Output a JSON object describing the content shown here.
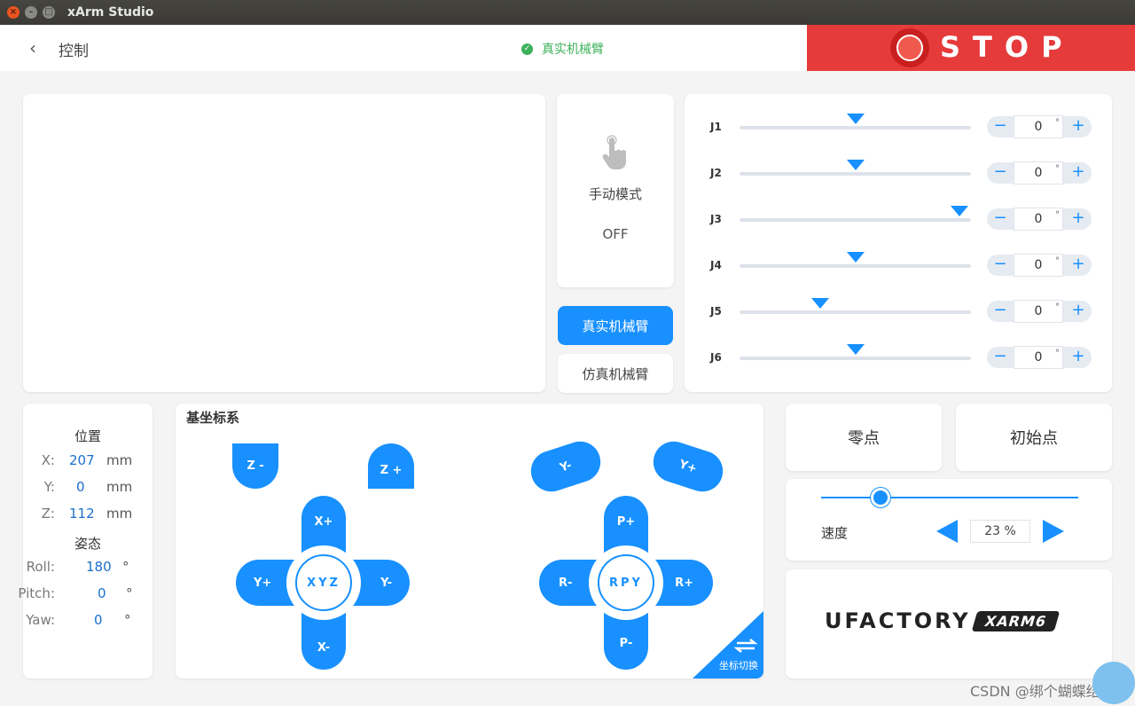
{
  "window": {
    "title": "xArm Studio"
  },
  "header": {
    "back_label": "控制",
    "status_text": "真实机械臂",
    "stop_label": "STOP"
  },
  "colors": {
    "accent": "#1890ff",
    "stop": "#e63b3b",
    "ok": "#3db15a"
  },
  "manual_mode": {
    "label": "手动模式",
    "value": "OFF",
    "icon": "hand-pointer-icon"
  },
  "arm_mode": {
    "real_label": "真实机械臂",
    "sim_label": "仿真机械臂",
    "selected": "real"
  },
  "joints": [
    {
      "label": "J1",
      "value": "0",
      "slider_fraction": 0.5
    },
    {
      "label": "J2",
      "value": "0",
      "slider_fraction": 0.5
    },
    {
      "label": "J3",
      "value": "0",
      "slider_fraction": 0.95
    },
    {
      "label": "J4",
      "value": "0",
      "slider_fraction": 0.5
    },
    {
      "label": "J5",
      "value": "0",
      "slider_fraction": 0.35
    },
    {
      "label": "J6",
      "value": "0",
      "slider_fraction": 0.5
    }
  ],
  "joint_unit": "°",
  "position": {
    "title": "位置",
    "rows": [
      {
        "key": "X:",
        "value": "207",
        "unit": "mm"
      },
      {
        "key": "Y:",
        "value": "0",
        "unit": "mm"
      },
      {
        "key": "Z:",
        "value": "112",
        "unit": "mm"
      }
    ],
    "attitude_title": "姿态",
    "attitude_rows": [
      {
        "key": "Roll:",
        "value": "180",
        "unit": "°"
      },
      {
        "key": "Pitch:",
        "value": "0",
        "unit": "°"
      },
      {
        "key": "Yaw:",
        "value": "0",
        "unit": "°"
      }
    ]
  },
  "jog": {
    "title": "基坐标系",
    "xyz": {
      "hub": "XYZ",
      "up": "X+",
      "down": "X-",
      "left": "Y+",
      "right": "Y-",
      "z_minus": "Z -",
      "z_plus": "Z +"
    },
    "rpy": {
      "hub": "RPY",
      "up": "P+",
      "down": "P-",
      "left": "R-",
      "right": "R+",
      "y_minus": "Y-",
      "y_plus": "Y+"
    },
    "switch_label": "坐标切换"
  },
  "actions": {
    "zero_label": "零点",
    "home_label": "初始点"
  },
  "speed": {
    "label": "速度",
    "value": "23 %",
    "fraction": 0.23
  },
  "brand": {
    "name": "UFACTORY",
    "model": "XARM6"
  },
  "watermark": "CSDN @绑个蝴蝶结"
}
